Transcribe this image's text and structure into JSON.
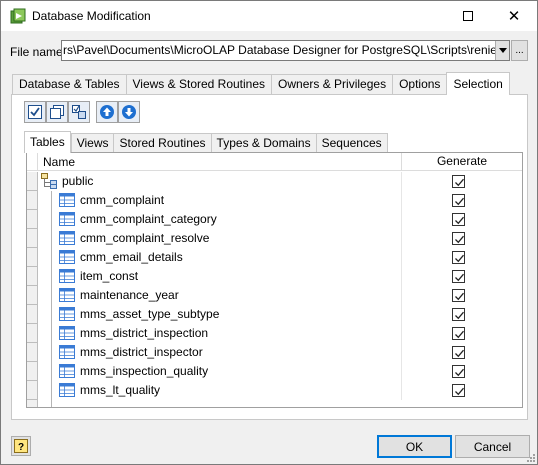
{
  "window": {
    "title": "Database Modification",
    "minimize_glyph": "—",
    "close_glyph": "✕"
  },
  "file": {
    "label": "File name",
    "value": "rs\\Pavel\\Documents\\MicroOLAP Database Designer for PostgreSQL\\Scripts\\renier.sql",
    "browse_label": "..."
  },
  "main_tabs": [
    {
      "label": "Database & Tables",
      "active": false
    },
    {
      "label": "Views & Stored Routines",
      "active": false
    },
    {
      "label": "Owners & Privileges",
      "active": false
    },
    {
      "label": "Options",
      "active": false
    },
    {
      "label": "Selection",
      "active": true
    }
  ],
  "toolbar_icons": [
    "check-all-icon",
    "uncheck-all-icon",
    "invert-selection-icon",
    "move-up-icon",
    "move-down-icon"
  ],
  "sub_tabs": [
    {
      "label": "Tables",
      "active": true
    },
    {
      "label": "Views",
      "active": false
    },
    {
      "label": "Stored Routines",
      "active": false
    },
    {
      "label": "Types & Domains",
      "active": false
    },
    {
      "label": "Sequences",
      "active": false
    }
  ],
  "grid": {
    "col_name": "Name",
    "col_generate": "Generate",
    "schema": {
      "name": "public",
      "generate": true
    },
    "tables": [
      {
        "name": "cmm_complaint",
        "generate": true
      },
      {
        "name": "cmm_complaint_category",
        "generate": true
      },
      {
        "name": "cmm_complaint_resolve",
        "generate": true
      },
      {
        "name": "cmm_email_details",
        "generate": true
      },
      {
        "name": "item_const",
        "generate": true
      },
      {
        "name": "maintenance_year",
        "generate": true
      },
      {
        "name": "mms_asset_type_subtype",
        "generate": true
      },
      {
        "name": "mms_district_inspection",
        "generate": true
      },
      {
        "name": "mms_district_inspector",
        "generate": true
      },
      {
        "name": "mms_inspection_quality",
        "generate": true
      },
      {
        "name": "mms_lt_quality",
        "generate": true
      }
    ]
  },
  "buttons": {
    "help_label": "?",
    "ok_label": "OK",
    "cancel_label": "Cancel"
  },
  "colors": {
    "accent": "#0078d7",
    "toolbar_arrow": "#1e6fd0",
    "table_icon": "#3a7bd5"
  }
}
